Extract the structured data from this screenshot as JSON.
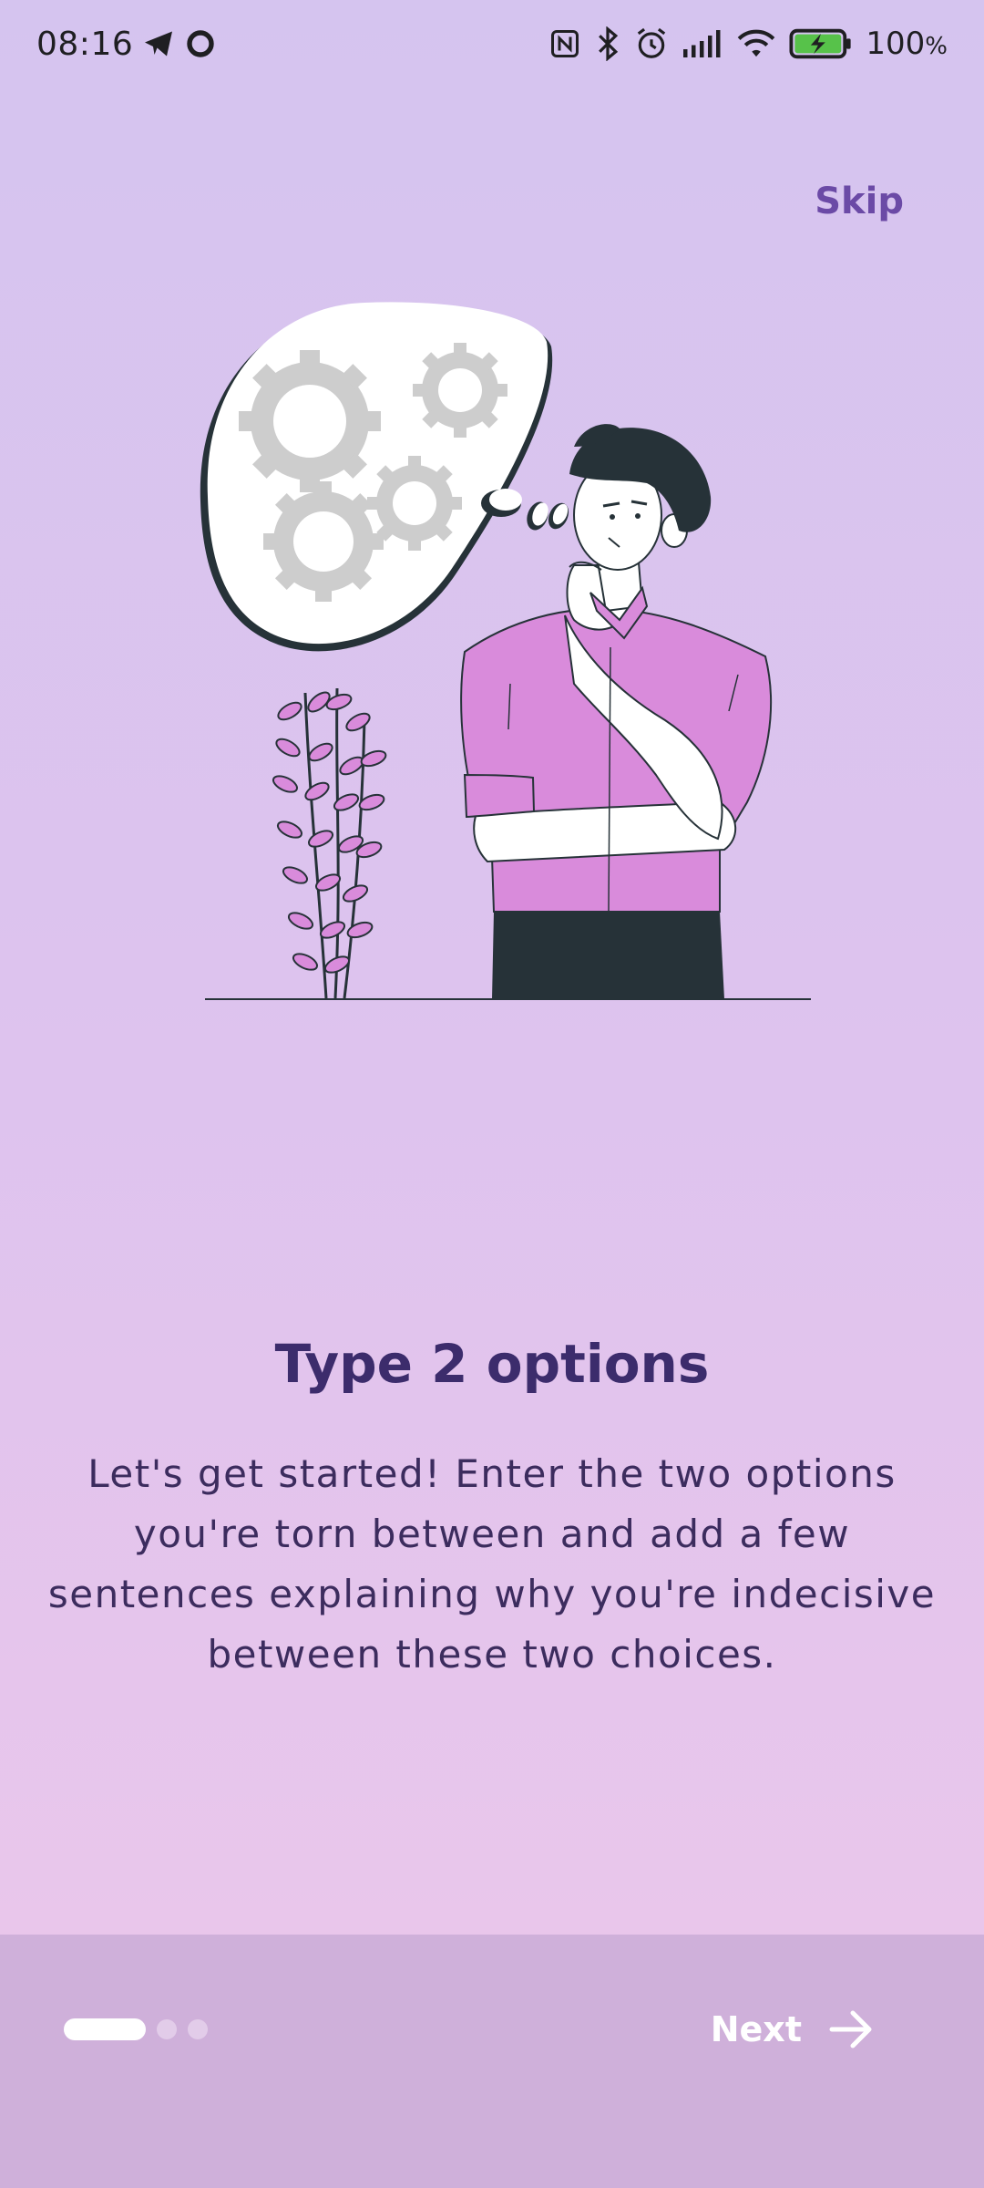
{
  "status_bar": {
    "time": "08:16",
    "battery_value": "100",
    "battery_unit": "%",
    "icons": [
      "telegram-icon",
      "circle-icon",
      "nfc-icon",
      "bluetooth-icon",
      "alarm-icon",
      "signal-icon",
      "wifi-icon",
      "battery-icon"
    ]
  },
  "header": {
    "skip_label": "Skip"
  },
  "illustration": {
    "icon": "thinking-person-illustration"
  },
  "content": {
    "title": "Type 2 options",
    "description": "Let's get started! Enter the two options you're torn between and add a few sentences explaining why you're indecisive between these two choices."
  },
  "footer": {
    "pager": {
      "total": 3,
      "current": 1
    },
    "next_label": "Next",
    "next_icon": "arrow-right-icon"
  },
  "colors": {
    "accent": "#6b4aa6",
    "title": "#3c2c6c",
    "bottom_bar": "#cfb0da",
    "shirt": "#d98bdb",
    "pants": "#263238"
  }
}
